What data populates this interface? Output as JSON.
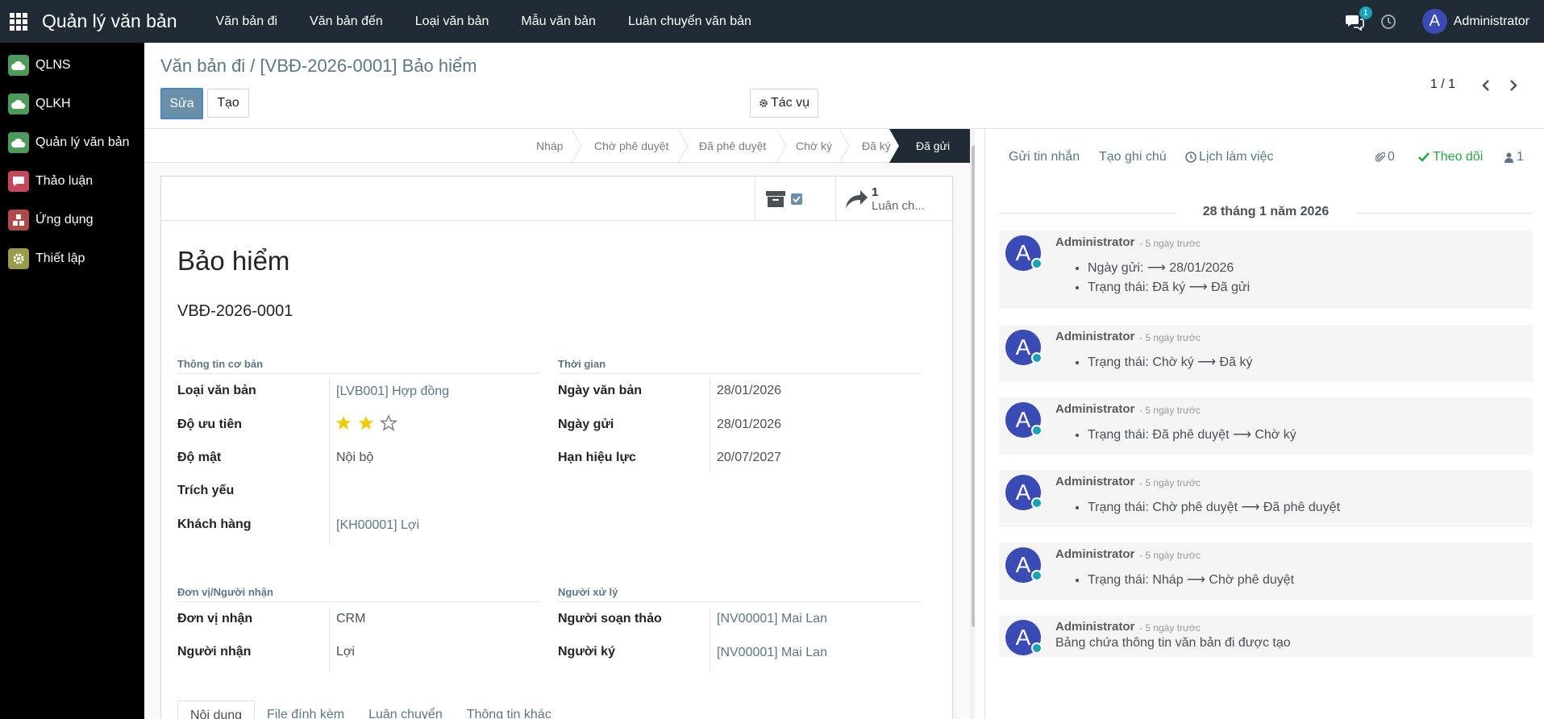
{
  "topbar": {
    "brand": "Quản lý văn bản",
    "menu": [
      "Văn bản đi",
      "Văn bản đến",
      "Loại văn bản",
      "Mẫu văn bản",
      "Luân chuyển văn bản"
    ],
    "chat_badge": "1",
    "avatar_letter": "A",
    "user": "Administrator"
  },
  "sidebar": {
    "items": [
      {
        "label": "QLNS",
        "color": "#4c9b5a"
      },
      {
        "label": "QLKH",
        "color": "#4c9b5a"
      },
      {
        "label": "Quản lý văn bản",
        "color": "#4c9b5a"
      },
      {
        "label": "Thảo luận",
        "color": "#c5485a"
      },
      {
        "label": "Ứng dụng",
        "color": "#b04a4a"
      },
      {
        "label": "Thiết lập",
        "color": "#9b9b4c"
      }
    ]
  },
  "control": {
    "breadcrumb": "Văn bản đi / [VBĐ-2026-0001] Bảo hiểm",
    "edit": "Sửa",
    "create": "Tạo",
    "action": "Tác vụ",
    "pager": "1 / 1"
  },
  "status": {
    "stages": [
      "Nháp",
      "Chờ phê duyệt",
      "Đã phê duyệt",
      "Chờ ký",
      "Đã ký",
      "Đã gửi"
    ],
    "active": "Đã gửi"
  },
  "buttonbox": {
    "transfer_count": "1",
    "transfer_label": "Luân ch..."
  },
  "record": {
    "title": "Bảo hiểm",
    "code": "VBĐ-2026-0001",
    "groups": {
      "basic": "Thông tin cơ bản",
      "time": "Thời gian",
      "receiver": "Đơn vị/Người nhận",
      "handler": "Người xử lý"
    },
    "labels": {
      "doc_type": "Loại văn bản",
      "priority": "Độ ưu tiên",
      "secrecy": "Độ mật",
      "summary": "Trích yếu",
      "customer": "Khách hàng",
      "doc_date": "Ngày văn bản",
      "send_date": "Ngày gửi",
      "expiry": "Hạn hiệu lực",
      "unit": "Đơn vị nhận",
      "recipient": "Người nhận",
      "drafter": "Người soạn thảo",
      "signer": "Người ký"
    },
    "values": {
      "doc_type": "[LVB001] Hợp đồng",
      "priority_stars": 2,
      "priority_max": 3,
      "secrecy": "Nội bộ",
      "summary": "",
      "customer": "[KH00001] Lợi",
      "doc_date": "28/01/2026",
      "send_date": "28/01/2026",
      "expiry": "20/07/2027",
      "unit": "CRM",
      "recipient": "Lợi",
      "drafter": "[NV00001] Mai Lan",
      "signer": "[NV00001] Mai Lan"
    },
    "tabs": [
      "Nội dung",
      "File đính kèm",
      "Luân chuyển",
      "Thông tin khác"
    ]
  },
  "chatter": {
    "send_message": "Gửi tin nhắn",
    "log_note": "Tạo ghi chú",
    "activity": "Lịch làm việc",
    "attachments": "0",
    "follow": "Theo dõi",
    "followers": "1",
    "date": "28 tháng 1 năm 2026",
    "messages": [
      {
        "author": "Administrator",
        "time": "- 5 ngày trước",
        "lines": [
          "Ngày gửi: ⟶ 28/01/2026",
          "Trạng thái: Đã ký ⟶ Đã gửi"
        ]
      },
      {
        "author": "Administrator",
        "time": "- 5 ngày trước",
        "lines": [
          "Trạng thái: Chờ ký ⟶ Đã ký"
        ]
      },
      {
        "author": "Administrator",
        "time": "- 5 ngày trước",
        "lines": [
          "Trạng thái: Đã phê duyệt ⟶ Chờ ký"
        ]
      },
      {
        "author": "Administrator",
        "time": "- 5 ngày trước",
        "lines": [
          "Trạng thái: Chờ phê duyệt ⟶ Đã phê duyệt"
        ]
      },
      {
        "author": "Administrator",
        "time": "- 5 ngày trước",
        "lines": [
          "Trạng thái: Nháp ⟶ Chờ phê duyệt"
        ]
      },
      {
        "author": "Administrator",
        "time": "- 5 ngày trước",
        "body": "Bảng chứa thông tin văn bản đi được tạo"
      }
    ]
  }
}
